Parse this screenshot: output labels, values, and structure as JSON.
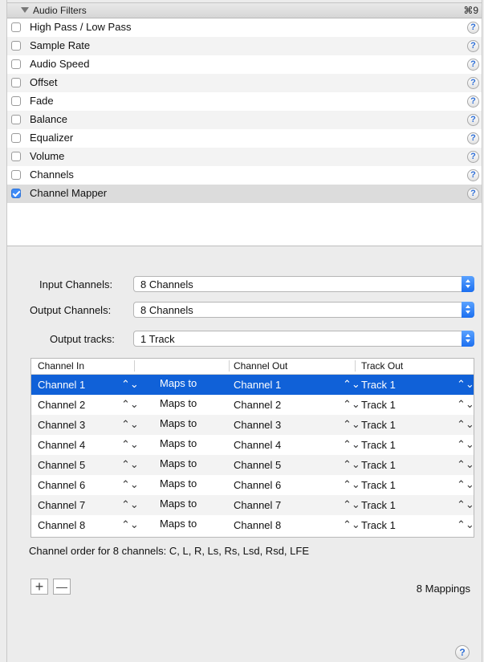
{
  "section": {
    "title": "Audio Filters",
    "shortcut": "⌘9",
    "collapse_icon": "disclosure-triangle-down"
  },
  "filters": [
    {
      "label": "High Pass / Low Pass",
      "checked": false
    },
    {
      "label": "Sample Rate",
      "checked": false
    },
    {
      "label": "Audio Speed",
      "checked": false
    },
    {
      "label": "Offset",
      "checked": false
    },
    {
      "label": "Fade",
      "checked": false
    },
    {
      "label": "Balance",
      "checked": false
    },
    {
      "label": "Equalizer",
      "checked": false
    },
    {
      "label": "Volume",
      "checked": false
    },
    {
      "label": "Channels",
      "checked": false
    },
    {
      "label": "Channel Mapper",
      "checked": true
    }
  ],
  "help_glyph": "?",
  "params": {
    "input_channels": {
      "label": "Input Channels:",
      "value": "8 Channels"
    },
    "output_channels": {
      "label": "Output Channels:",
      "value": "8 Channels"
    },
    "output_tracks": {
      "label": "Output tracks:",
      "value": "1 Track"
    }
  },
  "table": {
    "headers": {
      "channel_in": "Channel In",
      "channel_out": "Channel Out",
      "track_out": "Track Out"
    },
    "stepper_glyph": "⌃⌄",
    "rows": [
      {
        "in": "Channel 1",
        "maps": "Maps to",
        "out": "Channel 1",
        "track": "Track 1",
        "selected": true
      },
      {
        "in": "Channel 2",
        "maps": "Maps to",
        "out": "Channel 2",
        "track": "Track 1",
        "selected": false
      },
      {
        "in": "Channel 3",
        "maps": "Maps to",
        "out": "Channel 3",
        "track": "Track 1",
        "selected": false
      },
      {
        "in": "Channel 4",
        "maps": "Maps to",
        "out": "Channel 4",
        "track": "Track 1",
        "selected": false
      },
      {
        "in": "Channel 5",
        "maps": "Maps to",
        "out": "Channel 5",
        "track": "Track 1",
        "selected": false
      },
      {
        "in": "Channel 6",
        "maps": "Maps to",
        "out": "Channel 6",
        "track": "Track 1",
        "selected": false
      },
      {
        "in": "Channel 7",
        "maps": "Maps to",
        "out": "Channel 7",
        "track": "Track 1",
        "selected": false
      },
      {
        "in": "Channel 8",
        "maps": "Maps to",
        "out": "Channel 8",
        "track": "Track 1",
        "selected": false
      }
    ]
  },
  "order_text": "Channel order for 8 channels: C, L, R, Ls, Rs, Lsd, Rsd, LFE",
  "buttons": {
    "add": "+",
    "remove": "—"
  },
  "mappings_count": "8 Mappings",
  "colors": {
    "selection": "#1061d8",
    "checkbox_checked": "#3d8af7",
    "popup_arrows": "#2f7bf5"
  }
}
